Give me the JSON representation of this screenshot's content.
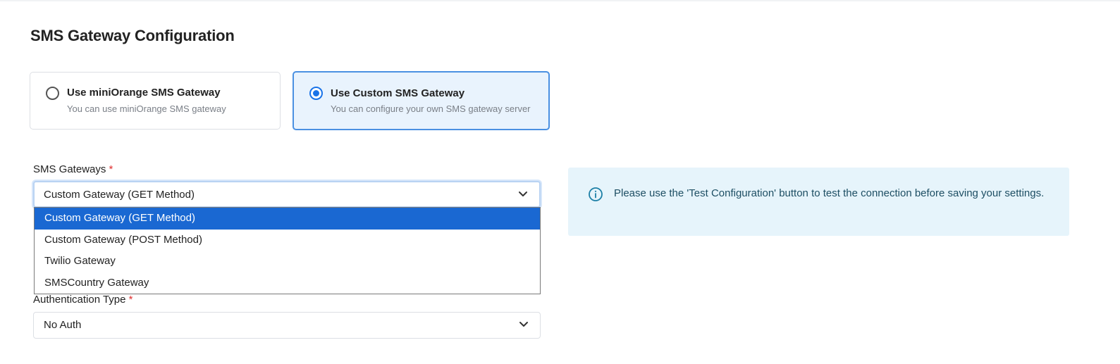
{
  "page": {
    "title": "SMS Gateway Configuration"
  },
  "gateway_options": [
    {
      "title": "Use miniOrange SMS Gateway",
      "subtitle": "You can use miniOrange SMS gateway",
      "selected": false
    },
    {
      "title": "Use Custom SMS Gateway",
      "subtitle": "You can configure your own SMS gateway server",
      "selected": true
    }
  ],
  "sms_gateways": {
    "label": "SMS Gateways",
    "required_mark": "*",
    "value": "Custom Gateway (GET Method)",
    "options": [
      "Custom Gateway (GET Method)",
      "Custom Gateway (POST Method)",
      "Twilio Gateway",
      "SMSCountry Gateway"
    ],
    "highlighted_option": "Custom Gateway (GET Method)"
  },
  "authentication_type": {
    "label": "Authentication Type",
    "required_mark": "*",
    "value": "No Auth"
  },
  "info": {
    "icon": "info-icon",
    "text": "Please use the 'Test Configuration' button to test the connection before saving your settings."
  },
  "colors": {
    "accent": "#1a73e8",
    "selected_option_bg": "#1a68d2",
    "info_bg": "#e6f4fb",
    "required": "#e03131"
  }
}
